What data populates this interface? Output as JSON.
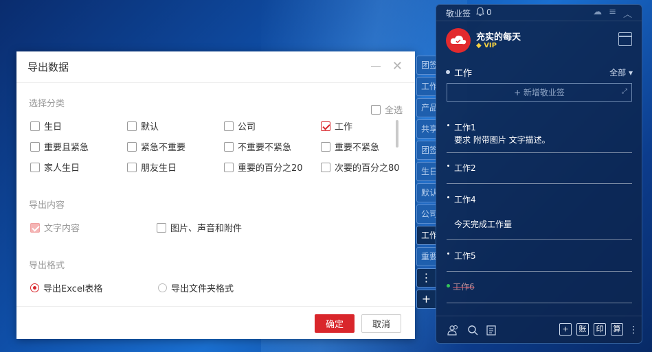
{
  "dialog": {
    "title": "导出数据",
    "categories_label": "选择分类",
    "select_all": "全选",
    "categories": [
      {
        "label": "生日",
        "checked": false
      },
      {
        "label": "默认",
        "checked": false
      },
      {
        "label": "公司",
        "checked": false
      },
      {
        "label": "工作",
        "checked": true
      },
      {
        "label": "重要且紧急",
        "checked": false
      },
      {
        "label": "紧急不重要",
        "checked": false
      },
      {
        "label": "不重要不紧急",
        "checked": false
      },
      {
        "label": "重要不紧急",
        "checked": false
      },
      {
        "label": "家人生日",
        "checked": false
      },
      {
        "label": "朋友生日",
        "checked": false
      },
      {
        "label": "重要的百分之20",
        "checked": false
      },
      {
        "label": "次要的百分之80",
        "checked": false
      }
    ],
    "content_label": "导出内容",
    "content_text": "文字内容",
    "content_media": "图片、声音和附件",
    "format_label": "导出格式",
    "format_excel": "导出Excel表格",
    "format_folder": "导出文件夹格式",
    "ok": "确定",
    "cancel": "取消"
  },
  "side_tabs": [
    "团签",
    "工作",
    "产品",
    "共享",
    "团签",
    "生日",
    "默认",
    "公司",
    "工作",
    "重要"
  ],
  "side_more": "⋮",
  "side_add": "+",
  "panel": {
    "app_name": "敬业签",
    "notif_count": "0",
    "username": "充实的每天",
    "vip": "VIP",
    "category": "工作",
    "filter": "全部",
    "new_note": "+ 新增敬业签",
    "notes": [
      {
        "title": "工作1",
        "body": "要求  附带图片  文字描述。"
      },
      {
        "title": "工作2",
        "body": ""
      },
      {
        "title": "工作4",
        "body": "今天完成工作量"
      },
      {
        "title": "工作5",
        "body": ""
      },
      {
        "title": "工作6",
        "body": ""
      }
    ],
    "bottom_buttons": [
      "+",
      "账",
      "印",
      "算"
    ]
  }
}
